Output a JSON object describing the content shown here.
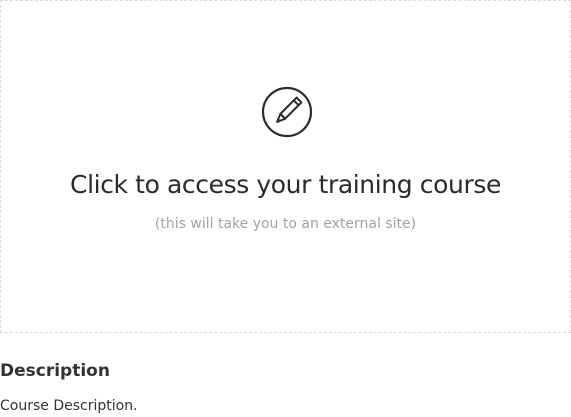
{
  "launch_card": {
    "icon": "pencil-icon",
    "title": "Click to access your training course",
    "subtitle": "(this will take you to an external site)"
  },
  "description": {
    "heading": "Description",
    "body": "Course Description."
  }
}
